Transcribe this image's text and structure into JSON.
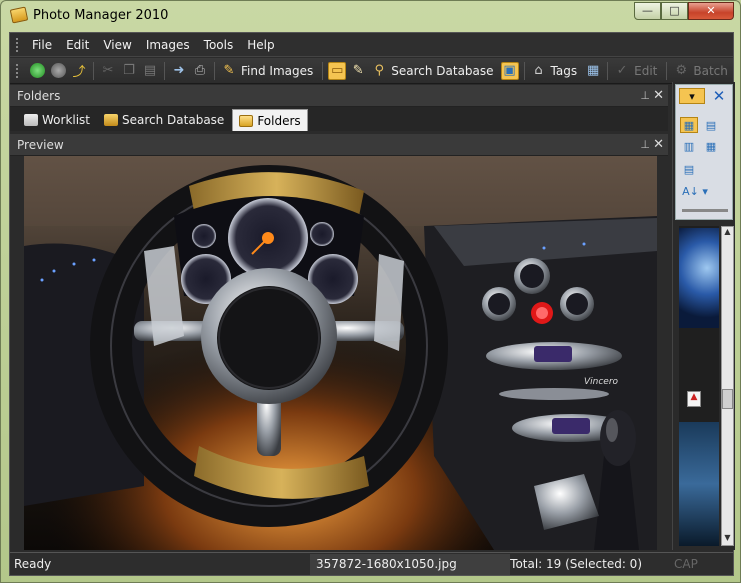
{
  "window": {
    "title": "Photo Manager 2010",
    "controls": {
      "minimize": "—",
      "maximize": "□",
      "close": "✕"
    }
  },
  "menu": [
    "File",
    "Edit",
    "View",
    "Images",
    "Tools",
    "Help"
  ],
  "toolbar": {
    "find_images": "Find Images",
    "search_database": "Search Database",
    "tags": "Tags",
    "edit": "Edit",
    "batch": "Batch"
  },
  "folders_panel": {
    "title": "Folders",
    "tabs": [
      "Worklist",
      "Search Database",
      "Folders"
    ],
    "active_tab": "Folders"
  },
  "preview_panel": {
    "title": "Preview"
  },
  "status": {
    "ready": "Ready",
    "file": "357872-1680x1050.jpg",
    "total": "Total: 19 (Selected: 0)",
    "cap": "CAP"
  },
  "colors": {
    "accent": "#f5c451",
    "dark_bg": "#2b2b2b",
    "frame": "#bfcf9a"
  }
}
